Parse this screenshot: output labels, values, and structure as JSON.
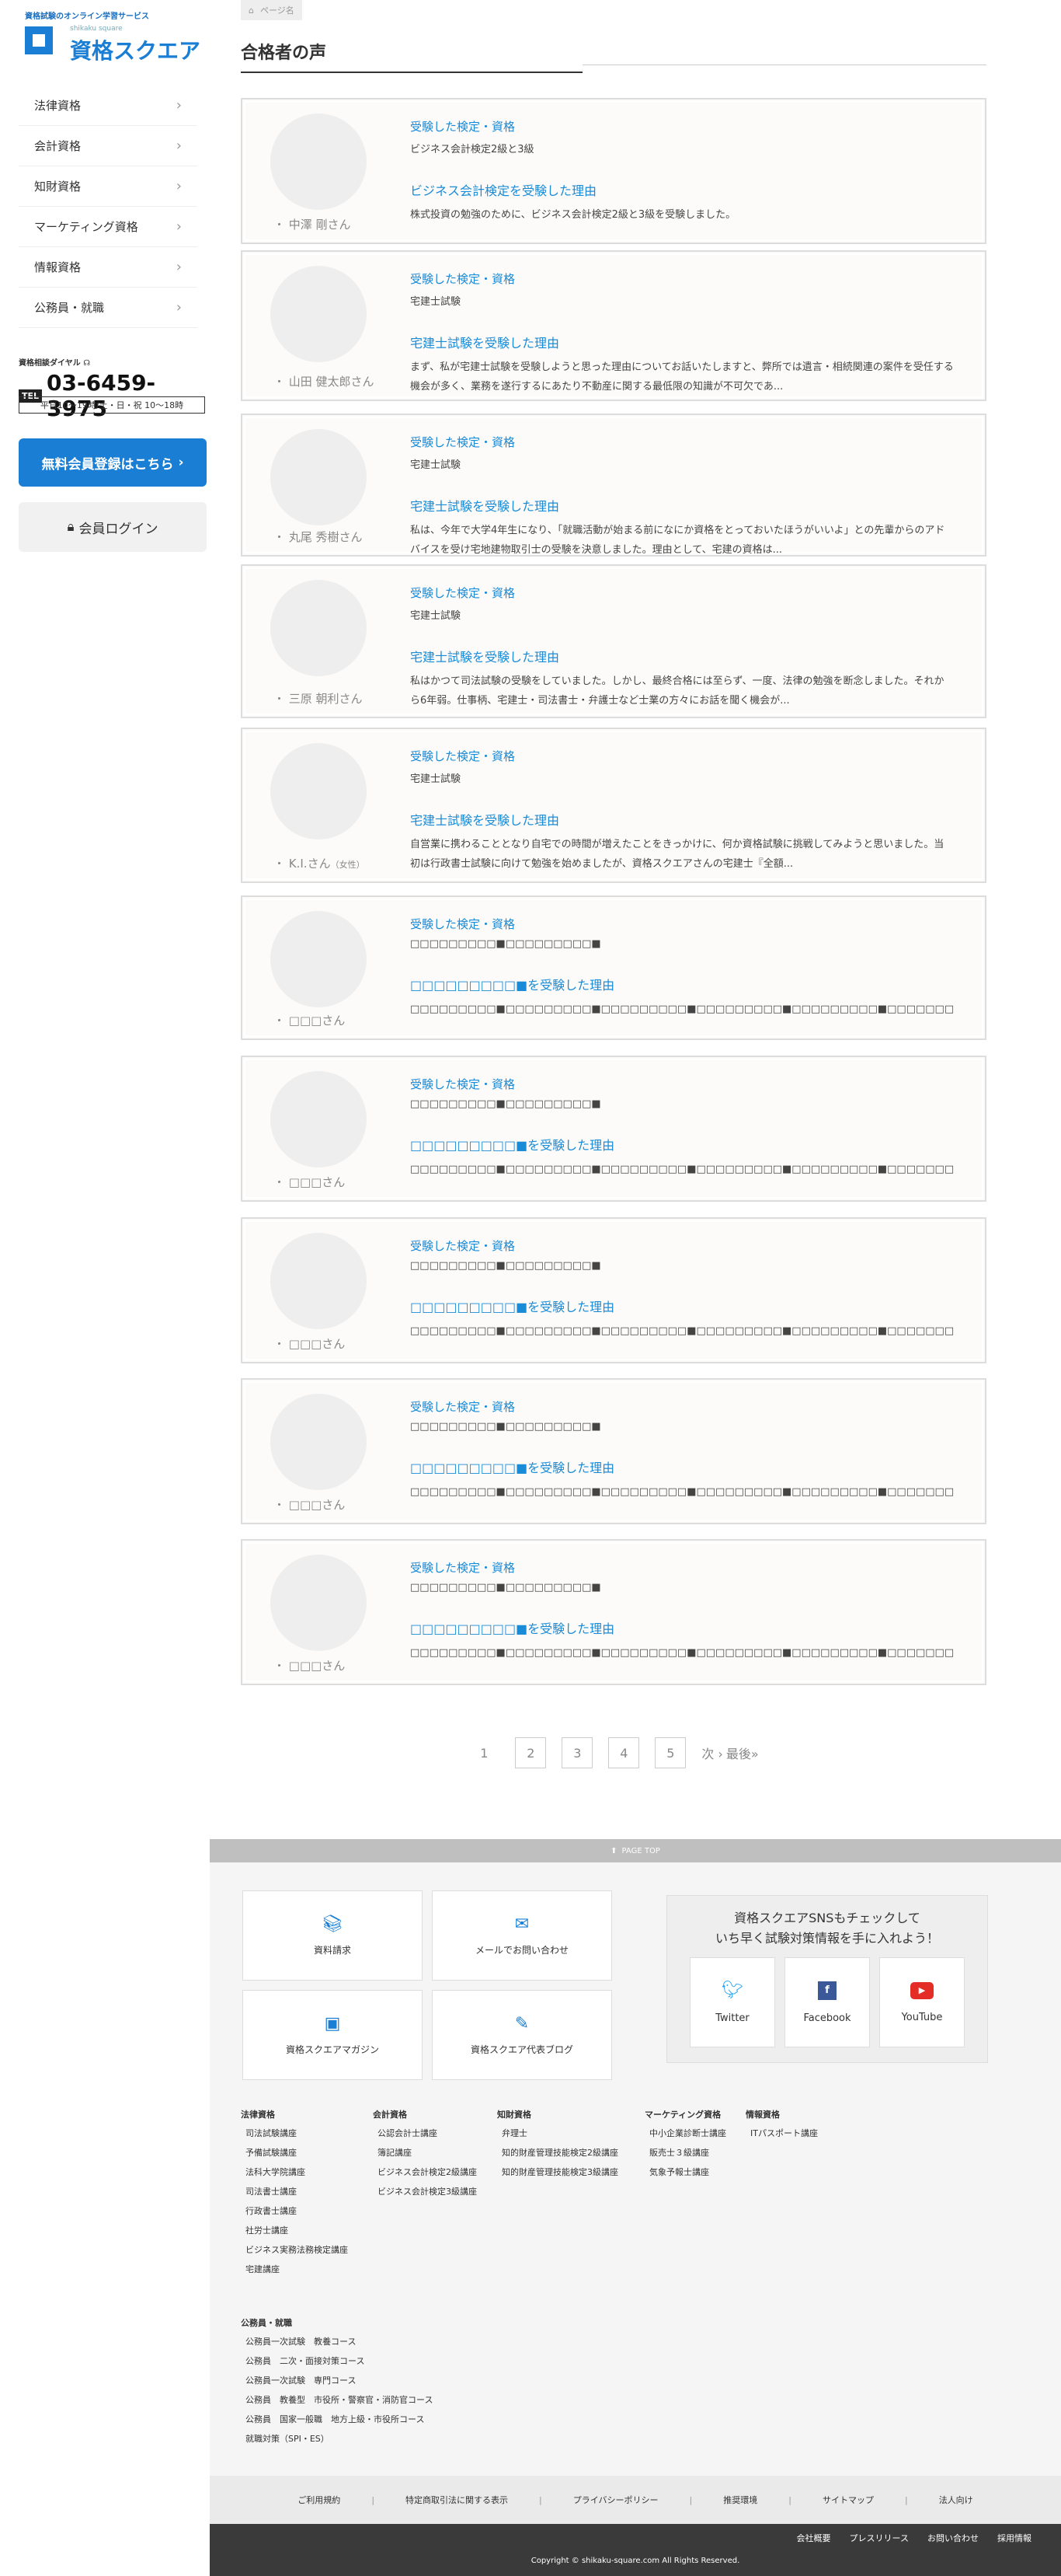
{
  "sidebar": {
    "tagline": "資格試験のオンライン学習サービス",
    "logo_sub": "shikaku square",
    "logo_text": "資格スクエア",
    "nav": [
      {
        "label": "法律資格"
      },
      {
        "label": "会計資格"
      },
      {
        "label": "知財資格"
      },
      {
        "label": "マーケティング資格"
      },
      {
        "label": "情報資格"
      },
      {
        "label": "公務員・就職"
      }
    ],
    "dial_label": "資格相談ダイヤル",
    "tel_badge": "TEL",
    "tel_number": "03-6459-3975",
    "hours": "平日10〜19時/土・日・祝 10〜18時",
    "register_label": "無料会員登録はこちら",
    "login_label": "会員ログイン"
  },
  "breadcrumb": {
    "current": "ページ名"
  },
  "page_title": "合格者の声",
  "testimonials": [
    {
      "name": "中澤 剛さん",
      "gender": "",
      "exam_heading": "受験した検定・資格",
      "exam": "ビジネス会計検定2級と3級",
      "reason_heading": "ビジネス会計検定を受験した理由",
      "reason": "株式投資の勉強のために、ビジネス会計検定2級と3級を受験しました。"
    },
    {
      "name": "山田 健太郎さん",
      "gender": "",
      "exam_heading": "受験した検定・資格",
      "exam": "宅建士試験",
      "reason_heading": "宅建士試験を受験した理由",
      "reason": "まず、私が宅建士試験を受験しようと思った理由についてお話いたしますと、弊所では遺言・相続関連の案件を受任する機会が多く、業務を遂行するにあたり不動産に関する最低限の知識が不可欠であ..."
    },
    {
      "name": "丸尾 秀樹さん",
      "gender": "",
      "exam_heading": "受験した検定・資格",
      "exam": "宅建士試験",
      "reason_heading": "宅建士試験を受験した理由",
      "reason": "私は、今年で大学4年生になり、「就職活動が始まる前になにか資格をとっておいたほうがいいよ」との先輩からのアドバイスを受け宅地建物取引士の受験を決意しました。理由として、宅建の資格は..."
    },
    {
      "name": "三原 朝利さん",
      "gender": "",
      "exam_heading": "受験した検定・資格",
      "exam": "宅建士試験",
      "reason_heading": "宅建士試験を受験した理由",
      "reason": "私はかつて司法試験の受験をしていました。しかし、最終合格には至らず、一度、法律の勉強を断念しました。それから6年弱。仕事柄、宅建士・司法書士・弁護士など士業の方々にお話を聞く機会が..."
    },
    {
      "name": "K.I.さん",
      "gender": "（女性）",
      "exam_heading": "受験した検定・資格",
      "exam": "宅建士試験",
      "reason_heading": "宅建士試験を受験した理由",
      "reason": "自営業に携わることとなり自宅での時間が増えたことをきっかけに、何か資格試験に挑戦してみようと思いました。当初は行政書士試験に向けて勉強を始めましたが、資格スクエアさんの宅建士『全額..."
    },
    {
      "name": "□□□さん",
      "gender": "",
      "exam_heading": "受験した検定・資格",
      "exam": "□□□□□□□□□■□□□□□□□□□■",
      "reason_heading": "□□□□□□□□□■を受験した理由",
      "reason": "□□□□□□□□□■□□□□□□□□□■□□□□□□□□□■□□□□□□□□□■□□□□□□□□□■□□□□□□□□□■□□□□□□□□□■□□□□□□□□□■□□□□□□□□□■□□□□□□□□□■□□□□□□□□□■□□□□□□□□□■"
    },
    {
      "name": "□□□さん",
      "gender": "",
      "exam_heading": "受験した検定・資格",
      "exam": "□□□□□□□□□■□□□□□□□□□■",
      "reason_heading": "□□□□□□□□□■を受験した理由",
      "reason": "□□□□□□□□□■□□□□□□□□□■□□□□□□□□□■□□□□□□□□□■□□□□□□□□□■□□□□□□□□□■□□□□□□□□□■□□□□□□□□□■□□□□□□□□□■□□□□□□□□□■□□□□□□□□□■□□□□□□□□□■"
    },
    {
      "name": "□□□さん",
      "gender": "",
      "exam_heading": "受験した検定・資格",
      "exam": "□□□□□□□□□■□□□□□□□□□■",
      "reason_heading": "□□□□□□□□□■を受験した理由",
      "reason": "□□□□□□□□□■□□□□□□□□□■□□□□□□□□□■□□□□□□□□□■□□□□□□□□□■□□□□□□□□□■□□□□□□□□□■□□□□□□□□□■□□□□□□□□□■□□□□□□□□□■□□□□□□□□□■□□□□□□□□□■"
    },
    {
      "name": "□□□さん",
      "gender": "",
      "exam_heading": "受験した検定・資格",
      "exam": "□□□□□□□□□■□□□□□□□□□■",
      "reason_heading": "□□□□□□□□□■を受験した理由",
      "reason": "□□□□□□□□□■□□□□□□□□□■□□□□□□□□□■□□□□□□□□□■□□□□□□□□□■□□□□□□□□□■□□□□□□□□□■□□□□□□□□□■□□□□□□□□□■□□□□□□□□□■□□□□□□□□□■□□□□□□□□□■"
    },
    {
      "name": "□□□さん",
      "gender": "",
      "exam_heading": "受験した検定・資格",
      "exam": "□□□□□□□□□■□□□□□□□□□■",
      "reason_heading": "□□□□□□□□□■を受験した理由",
      "reason": "□□□□□□□□□■□□□□□□□□□■□□□□□□□□□■□□□□□□□□□■□□□□□□□□□■□□□□□□□□□■□□□□□□□□□■□□□□□□□□□■□□□□□□□□□■□□□□□□□□□■□□□□□□□□□■□□□□□□□□□■"
    }
  ],
  "pagination": {
    "pages": [
      "1",
      "2",
      "3",
      "4",
      "5"
    ],
    "current": "1",
    "next": "次 ›",
    "last": "最後»"
  },
  "footer": {
    "pagetop": "PAGE TOP",
    "boxes": [
      {
        "label": "資料請求",
        "icon": "books-icon"
      },
      {
        "label": "メールでお問い合わせ",
        "icon": "mail-icon"
      },
      {
        "label": "資格スクエアマガジン",
        "icon": "magazine-icon"
      },
      {
        "label": "資格スクエア代表ブログ",
        "icon": "blog-icon"
      }
    ],
    "sns_title_1": "資格スクエアSNSもチェックして",
    "sns_title_2": "いち早く試験対策情報を手に入れよう！",
    "sns": [
      {
        "label": "Twitter",
        "color": "#1da1f2"
      },
      {
        "label": "Facebook",
        "color": "#3b5998"
      },
      {
        "label": "YouTube",
        "color": "#e52d27"
      }
    ],
    "columns": [
      {
        "title": "法律資格",
        "items": [
          "司法試験講座",
          "予備試験講座",
          "法科大学院講座",
          "司法書士講座",
          "行政書士講座",
          "社労士講座",
          "ビジネス実務法務検定講座",
          "宅建講座"
        ]
      },
      {
        "title": "会計資格",
        "items": [
          "公認会計士講座",
          "簿記講座",
          "ビジネス会計検定2級講座",
          "ビジネス会計検定3級講座"
        ]
      },
      {
        "title": "知財資格",
        "items": [
          "弁理士",
          "知的財産管理技能検定2級講座",
          "知的財産管理技能検定3級講座"
        ]
      },
      {
        "title": "マーケティング資格",
        "items": [
          "中小企業診断士講座",
          "販売士３級講座",
          "気象予報士講座"
        ]
      },
      {
        "title": "情報資格",
        "items": [
          "ITパスポート講座"
        ]
      },
      {
        "title": "公務員・就職",
        "items": [
          "公務員一次試験　教養コース",
          "公務員　二次・面接対策コース",
          "公務員一次試験　専門コース",
          "公務員　教養型　市役所・警察官・消防官コース",
          "公務員　国家一般職　地方上級・市役所コース",
          "就職対策（SPI・ES）"
        ]
      }
    ],
    "bottom_links": [
      "ご利用規約",
      "特定商取引法に関する表示",
      "プライバシーポリシー",
      "推奨環境",
      "サイトマップ",
      "法人向け"
    ],
    "dark_links": [
      "会社概要",
      "プレスリリース",
      "お問い合わせ",
      "採用情報"
    ],
    "copyright": "Copyright © shikaku-square.com All Rights Reserved."
  }
}
